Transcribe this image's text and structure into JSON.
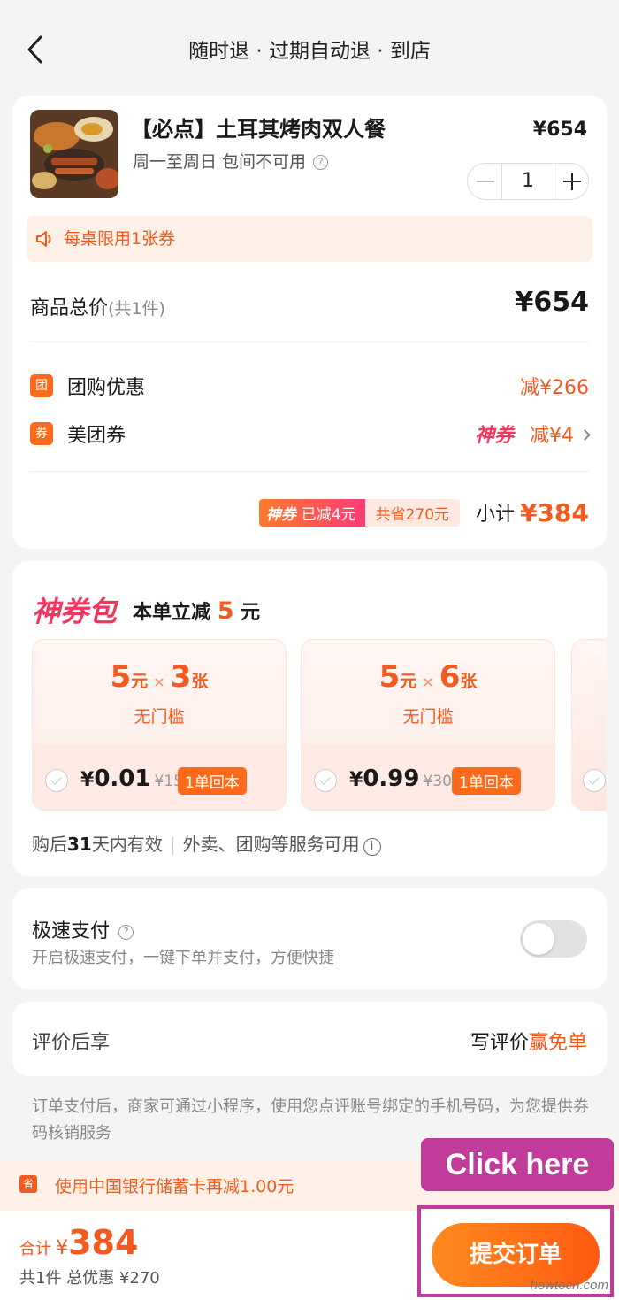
{
  "header": {
    "title": "随时退 · 过期自动退 · 到店"
  },
  "product": {
    "name": "【必点】土耳其烤肉双人餐",
    "price": "¥654",
    "note": "周一至周日 包间不可用",
    "quantity": "1",
    "limit_notice": "每桌限用1张券"
  },
  "summary": {
    "total_label": "商品总价",
    "total_count": "(共1件)",
    "total_value": "¥654",
    "discounts": [
      {
        "icon": "团",
        "label": "团购优惠",
        "value": "减¥266"
      },
      {
        "icon": "券",
        "label": "美团券",
        "tag": "神券",
        "value": "减¥4"
      }
    ],
    "badge_tag": "神券",
    "badge_text": "已减4元",
    "badge_save": "共省270元",
    "subtotal_label": "小计",
    "subtotal_value": "¥384"
  },
  "coupon_pack": {
    "title": "神券包",
    "subtitle_prefix": "本单立减",
    "subtitle_num": "5",
    "subtitle_suffix": "元",
    "tickets": [
      {
        "amount": "5",
        "unit": "元",
        "times": "×",
        "count": "3",
        "count_unit": "张",
        "condition": "无门槛",
        "price_sym": "¥",
        "price": "0.01",
        "original": "¥15",
        "badge": "1单回本"
      },
      {
        "amount": "5",
        "unit": "元",
        "times": "×",
        "count": "6",
        "count_unit": "张",
        "condition": "无门槛",
        "price_sym": "¥",
        "price": "0.99",
        "original": "¥30",
        "badge": "1单回本"
      }
    ],
    "validity_prefix": "购后",
    "validity_days": "31",
    "validity_suffix": "天内有效",
    "validity_scope": "外卖、团购等服务可用"
  },
  "fast_pay": {
    "title": "极速支付",
    "description": "开启极速支付，一键下单并支付，方便快捷",
    "enabled": false
  },
  "review": {
    "label": "评价后享",
    "action_prefix": "写评价",
    "action_highlight": "赢免单"
  },
  "disclaimer": "订单支付后，商家可通过小程序，使用您点评账号绑定的手机号码，为您提供券码核销服务",
  "bank_promo": {
    "icon": "省",
    "text": "使用中国银行储蓄卡再减1.00元"
  },
  "footer": {
    "total_label": "合计",
    "currency": "¥",
    "total_amount": "384",
    "count_text": "共1件",
    "discount_text": "总优惠 ¥270",
    "submit_label": "提交订单"
  },
  "annotation": {
    "callout": "Click here"
  },
  "watermark": "howtocn.com",
  "colors": {
    "accent": "#f35a1f",
    "brand_pink": "#f0385f",
    "callout": "#c03b9a",
    "background": "#f4f4f4"
  }
}
